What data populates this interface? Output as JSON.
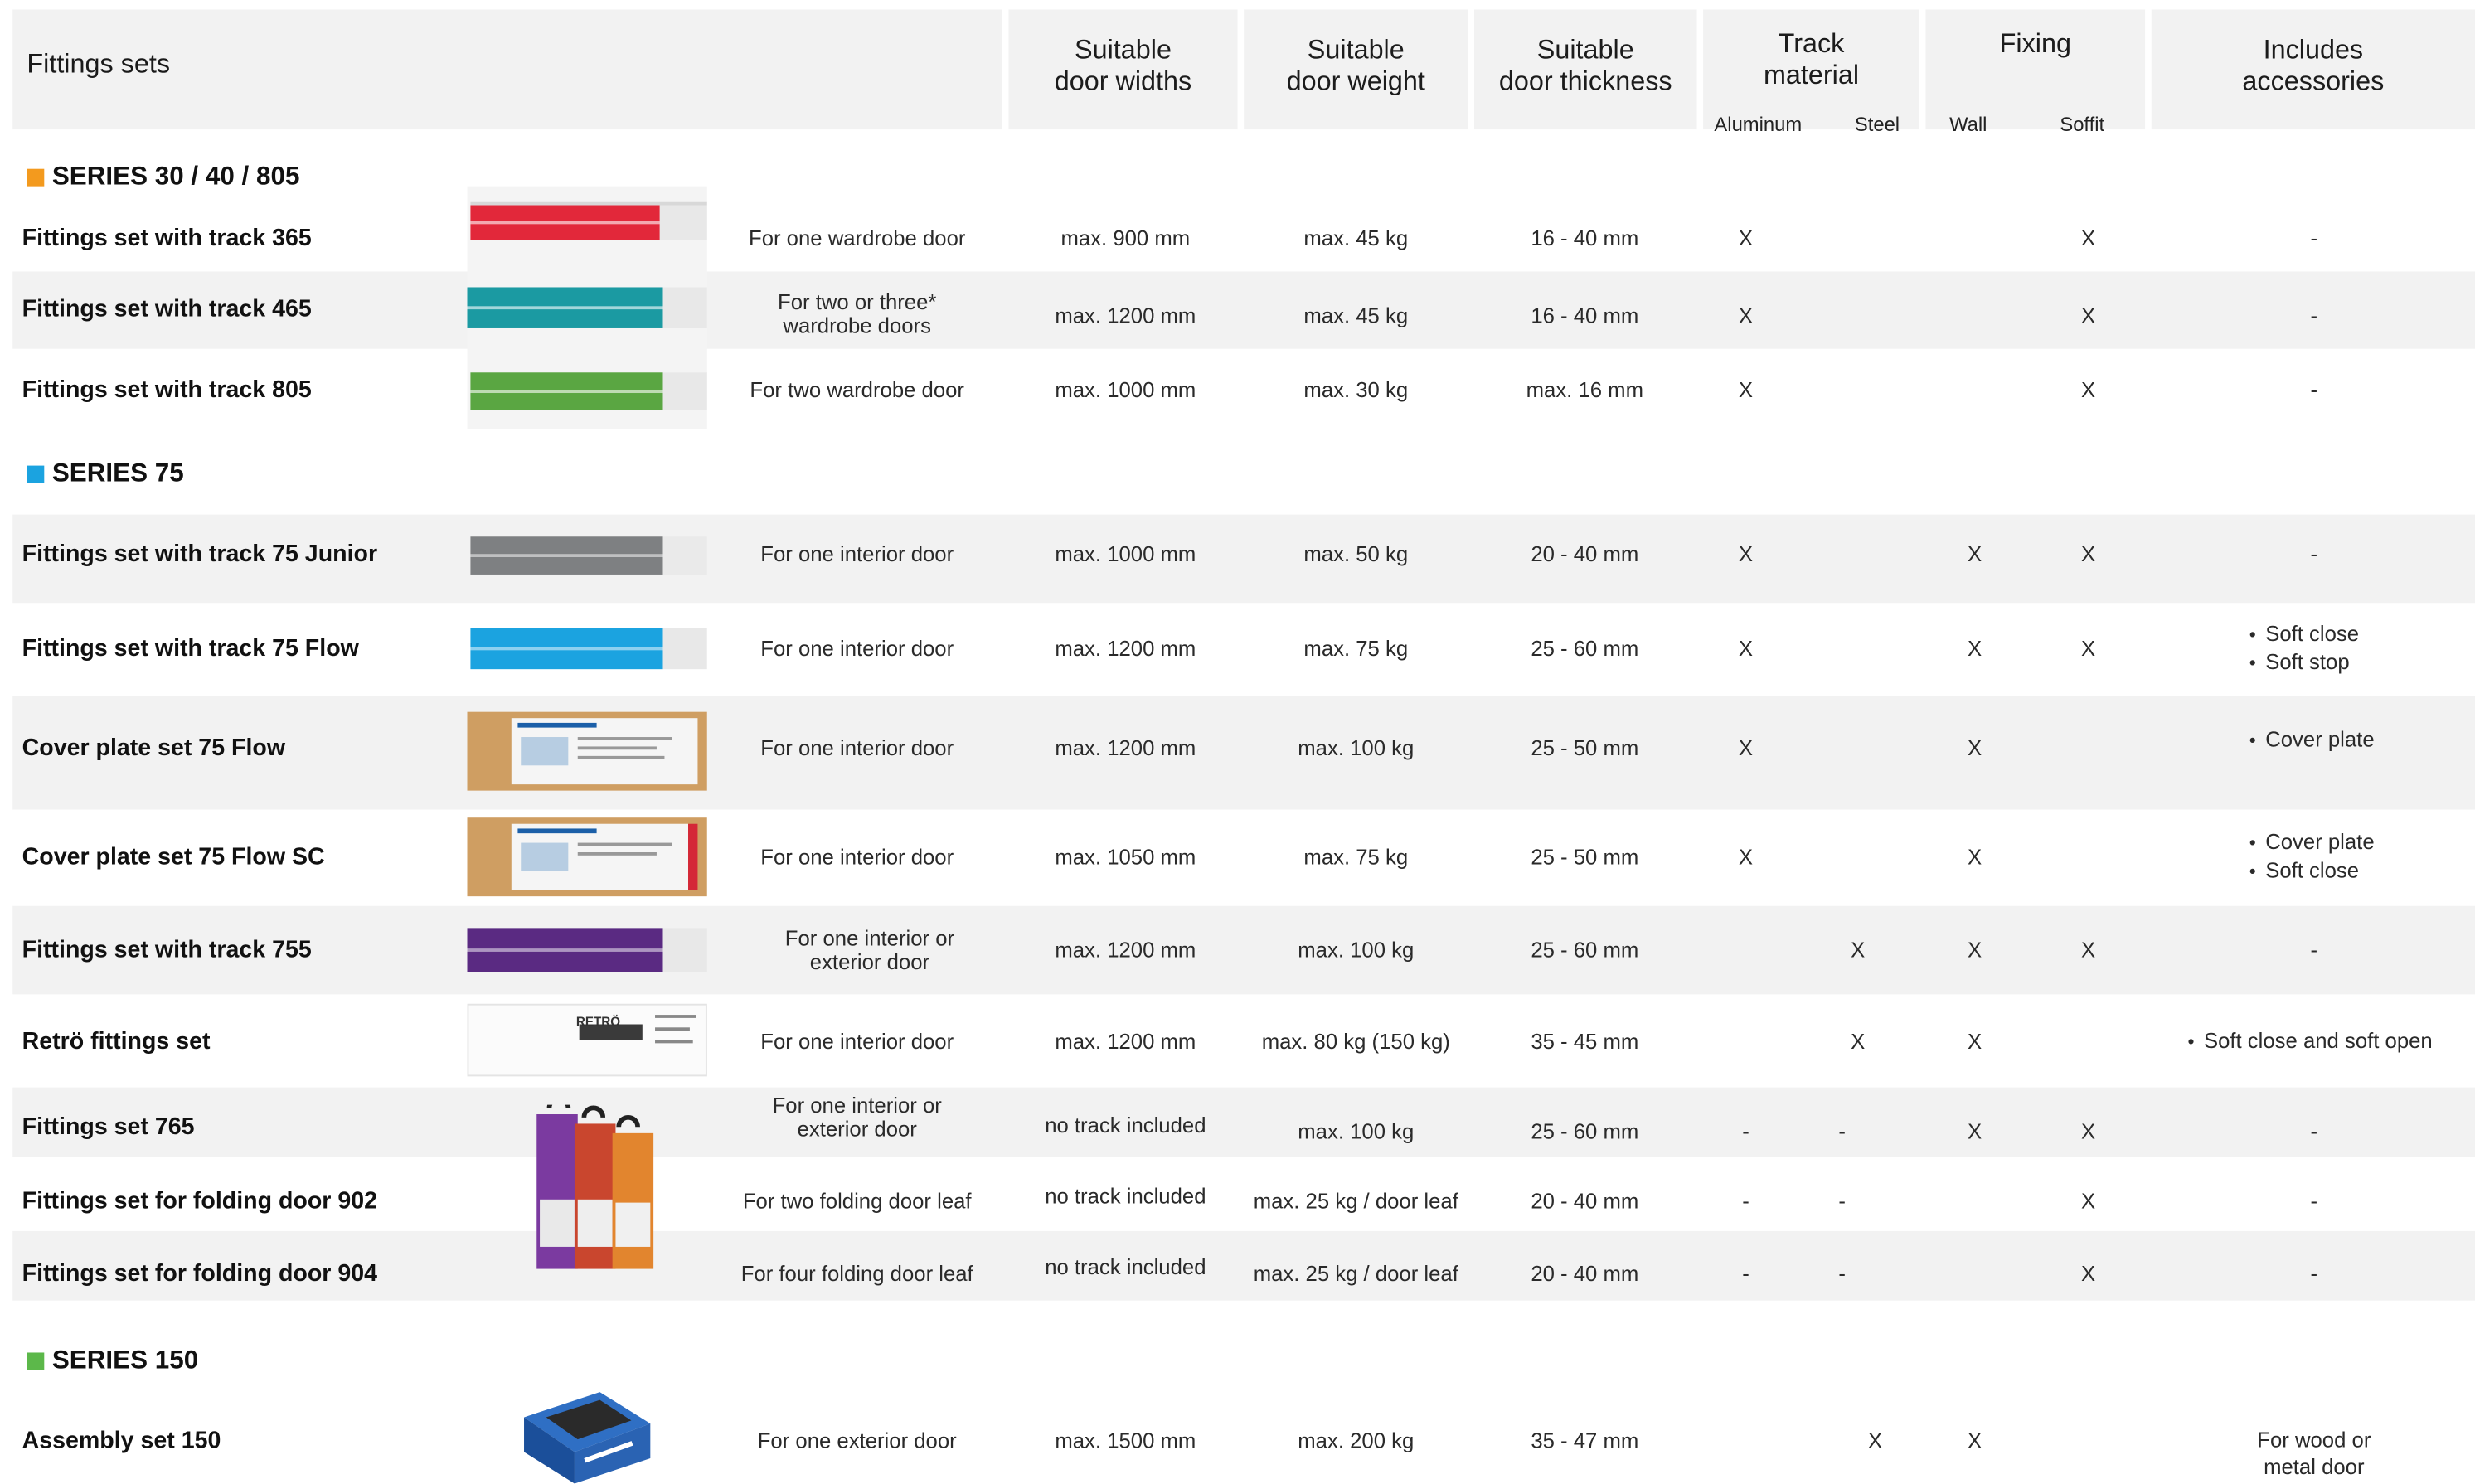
{
  "header": {
    "sets": "Fittings sets",
    "widths": "Suitable\ndoor widths",
    "weight": "Suitable\ndoor weight",
    "thickness": "Suitable\ndoor thickness",
    "track": "Track\nmaterial",
    "track_aluminum": "Aluminum",
    "track_steel": "Steel",
    "fixing": "Fixing",
    "fixing_wall": "Wall",
    "fixing_soffit": "Soffit",
    "accessories": "Includes\naccessories"
  },
  "colors": {
    "series_30": "#f39a1e",
    "series_75": "#1ba3e0",
    "series_150": "#5cb84a",
    "band": "#f2f2f2"
  },
  "series": [
    {
      "label": "SERIES 30 / 40 / 805",
      "color": "#f39a1e"
    },
    {
      "label": "SERIES 75",
      "color": "#1ba3e0"
    },
    {
      "label": "SERIES 150",
      "color": "#5cb84a"
    }
  ],
  "rows": [
    {
      "name": "Fittings set with track 365",
      "usage": "For one wardrobe door",
      "width": "max. 900 mm",
      "weight": "max. 45 kg",
      "thickness": "16 - 40 mm",
      "alu": "X",
      "steel": "",
      "wall": "",
      "soffit": "X",
      "acc": [
        "-"
      ],
      "image": "red-package-icon"
    },
    {
      "name": "Fittings set with track 465",
      "usage": "For two or three*\nwardrobe doors",
      "width": "max. 1200 mm",
      "weight": "max. 45 kg",
      "thickness": "16 - 40 mm",
      "alu": "X",
      "steel": "",
      "wall": "",
      "soffit": "X",
      "acc": [
        "-"
      ],
      "image": "teal-package-icon"
    },
    {
      "name": "Fittings set with track 805",
      "usage": "For two wardrobe door",
      "width": "max. 1000 mm",
      "weight": "max. 30 kg",
      "thickness": "max. 16 mm",
      "alu": "X",
      "steel": "",
      "wall": "",
      "soffit": "X",
      "acc": [
        "-"
      ],
      "image": "green-package-icon"
    },
    {
      "name": "Fittings set with track 75 Junior",
      "usage": "For one interior door",
      "width": "max. 1000 mm",
      "weight": "max. 50 kg",
      "thickness": "20 - 40 mm",
      "alu": "X",
      "steel": "",
      "wall": "X",
      "soffit": "X",
      "acc": [
        "-"
      ],
      "image": "grey-package-icon"
    },
    {
      "name": "Fittings set with track 75 Flow",
      "usage": "For one interior door",
      "width": "max. 1200 mm",
      "weight": "max. 75 kg",
      "thickness": "25 - 60 mm",
      "alu": "X",
      "steel": "",
      "wall": "X",
      "soffit": "X",
      "acc": [
        "Soft close",
        "Soft stop"
      ],
      "image": "blue-package-icon"
    },
    {
      "name": "Cover plate set 75 Flow",
      "usage": "For one interior door",
      "width": "max. 1200 mm",
      "weight": "max. 100 kg",
      "thickness": "25 - 50 mm",
      "alu": "X",
      "steel": "",
      "wall": "X",
      "soffit": "",
      "acc": [
        "Cover plate"
      ],
      "image": "cardboard-box-icon"
    },
    {
      "name": "Cover plate set 75 Flow SC",
      "usage": "For one interior door",
      "width": "max. 1050 mm",
      "weight": "max. 75 kg",
      "thickness": "25 - 50 mm",
      "alu": "X",
      "steel": "",
      "wall": "X",
      "soffit": "",
      "acc": [
        "Cover plate",
        "Soft close"
      ],
      "image": "cardboard-box-sc-icon"
    },
    {
      "name": "Fittings set with track 755",
      "usage": "For one interior or\nexterior door",
      "width": "max. 1200 mm",
      "weight": "max. 100 kg",
      "thickness": "25 - 60 mm",
      "alu": "",
      "steel": "X",
      "wall": "X",
      "soffit": "X",
      "acc": [
        "-"
      ],
      "image": "purple-package-icon"
    },
    {
      "name": "Retrö fittings set",
      "usage": "For one interior door",
      "width": "max. 1200 mm",
      "weight": "max. 80 kg (150 kg)",
      "thickness": "35 - 45 mm",
      "alu": "",
      "steel": "X",
      "wall": "X",
      "soffit": "",
      "acc": [
        "Soft close and soft open"
      ],
      "image": "retro-box-icon",
      "image_text": "RETRÖ"
    },
    {
      "name": "Fittings set 765",
      "usage": "For one interior or\nexterior door",
      "width": "no track included",
      "weight": "max. 100 kg",
      "thickness": "25 - 60 mm",
      "alu": "-",
      "steel": "-",
      "wall": "X",
      "soffit": "X",
      "acc": [
        "-"
      ],
      "image": "hanging-packs-icon"
    },
    {
      "name": "Fittings set for folding door 902",
      "usage": "For two folding door leaf",
      "width": "no track included",
      "weight": "max. 25 kg / door leaf",
      "thickness": "20 - 40 mm",
      "alu": "-",
      "steel": "-",
      "wall": "",
      "soffit": "X",
      "acc": [
        "-"
      ],
      "image": ""
    },
    {
      "name": "Fittings set for folding door 904",
      "usage": "For four folding door leaf",
      "width": "no track included",
      "weight": "max. 25 kg / door leaf",
      "thickness": "20 - 40 mm",
      "alu": "-",
      "steel": "-",
      "wall": "",
      "soffit": "X",
      "acc": [
        "-"
      ],
      "image": ""
    },
    {
      "name": "Assembly set 150",
      "usage": "For one exterior door",
      "width": "max. 1500 mm",
      "weight": "max. 200 kg",
      "thickness": "35 - 47 mm",
      "alu": "",
      "steel": "X",
      "wall": "X",
      "soffit": "",
      "acc_plain": "For wood or\nmetal door",
      "image": "blue-box-icon"
    }
  ]
}
